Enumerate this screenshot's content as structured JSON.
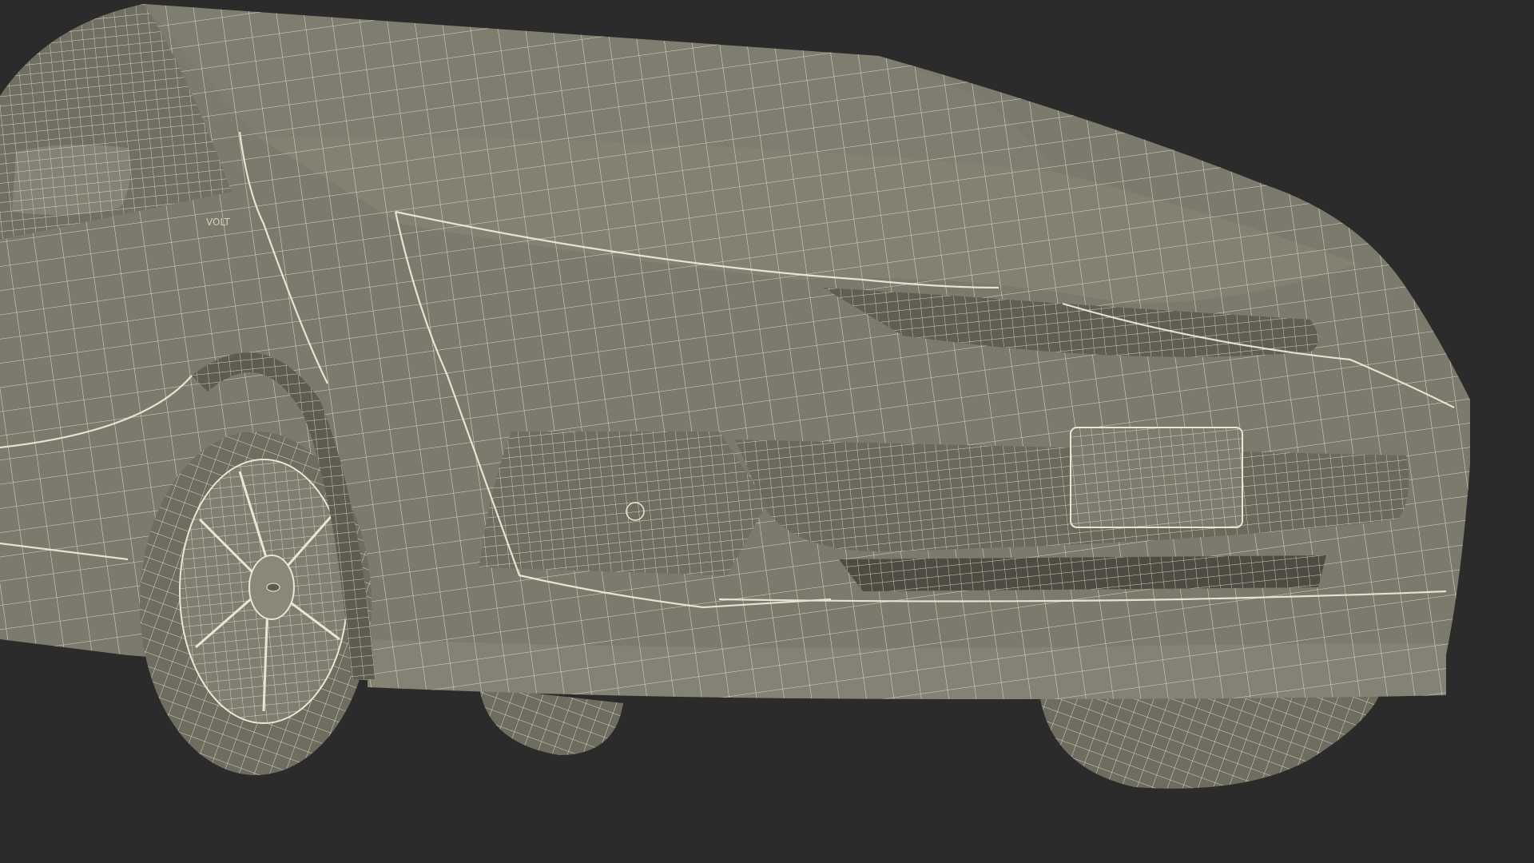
{
  "scene": {
    "subject": "car-front-wireframe-render",
    "colors": {
      "background": "#2b2b2b",
      "surface": "#7b7a6c",
      "surface_dark": "#5d5c50",
      "surface_light": "#8e8d7e",
      "wire": "#e9e6d2",
      "gap": "#45443b"
    },
    "badge_text": "VOLT"
  }
}
